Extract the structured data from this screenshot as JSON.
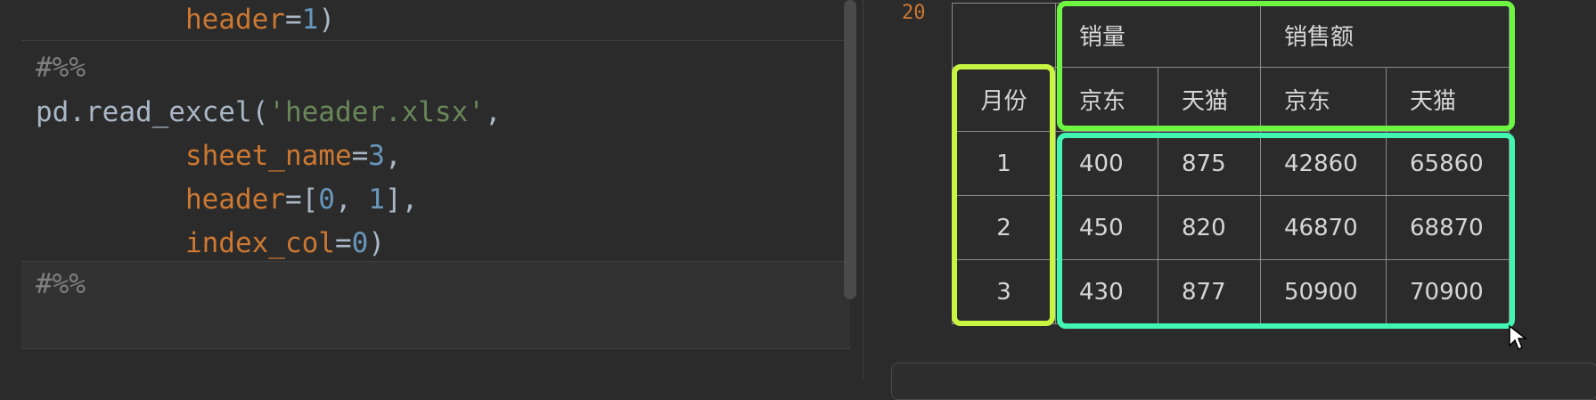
{
  "editor": {
    "lines": [
      {
        "indent": "         ",
        "tokens": [
          {
            "t": "header",
            "c": "param"
          },
          {
            "t": "=",
            "c": "op"
          },
          {
            "t": "1",
            "c": "num"
          },
          {
            "t": ")",
            "c": "op"
          }
        ]
      },
      {
        "indent": "",
        "tokens": [
          {
            "t": "#%%",
            "c": "comment"
          }
        ]
      },
      {
        "indent": "",
        "tokens": [
          {
            "t": "pd.read_excel(",
            "c": "fn"
          },
          {
            "t": "'header.xlsx'",
            "c": "str"
          },
          {
            "t": ",",
            "c": "op"
          }
        ]
      },
      {
        "indent": "         ",
        "tokens": [
          {
            "t": "sheet_name",
            "c": "param"
          },
          {
            "t": "=",
            "c": "op"
          },
          {
            "t": "3",
            "c": "num"
          },
          {
            "t": ",",
            "c": "op"
          }
        ]
      },
      {
        "indent": "         ",
        "tokens": [
          {
            "t": "header",
            "c": "param"
          },
          {
            "t": "=[",
            "c": "op"
          },
          {
            "t": "0",
            "c": "num"
          },
          {
            "t": ", ",
            "c": "op"
          },
          {
            "t": "1",
            "c": "num"
          },
          {
            "t": "],",
            "c": "op"
          }
        ]
      },
      {
        "indent": "         ",
        "tokens": [
          {
            "t": "index_col",
            "c": "param"
          },
          {
            "t": "=",
            "c": "op"
          },
          {
            "t": "0",
            "c": "num"
          },
          {
            "t": ")",
            "c": "op"
          }
        ]
      },
      {
        "indent": "",
        "tokens": [
          {
            "t": "#%%",
            "c": "comment"
          }
        ]
      }
    ]
  },
  "output": {
    "line_number": "20",
    "table": {
      "top_headers": [
        "销量",
        "销售额"
      ],
      "sub_headers": [
        "京东",
        "天猫",
        "京东",
        "天猫"
      ],
      "index_name": "月份",
      "rows": [
        {
          "index": "1",
          "values": [
            "400",
            "875",
            "42860",
            "65860"
          ]
        },
        {
          "index": "2",
          "values": [
            "450",
            "820",
            "46870",
            "68870"
          ]
        },
        {
          "index": "3",
          "values": [
            "430",
            "877",
            "50900",
            "70900"
          ]
        }
      ]
    }
  },
  "colors": {
    "highlight_index": "#c8f542",
    "highlight_header": "#6ef542",
    "highlight_values": "#42f5b0"
  }
}
